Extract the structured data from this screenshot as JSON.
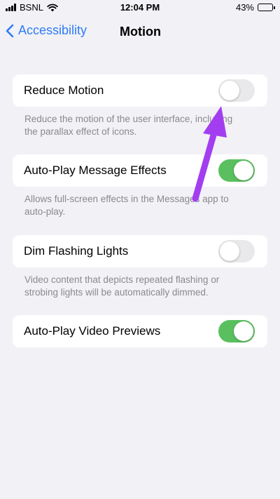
{
  "status_bar": {
    "carrier": "BSNL",
    "time": "12:04 PM",
    "battery": "43%"
  },
  "nav": {
    "back_label": "Accessibility",
    "title": "Motion"
  },
  "settings": [
    {
      "label": "Reduce Motion",
      "enabled": false,
      "footnote_line1": "Reduce the motion of the user interface, including",
      "footnote_line2": "the parallax effect of icons."
    },
    {
      "label": "Auto-Play Message Effects",
      "enabled": true,
      "footnote_line1": "Allows full-screen effects in the Messages app to",
      "footnote_line2": "auto-play."
    },
    {
      "label": "Dim Flashing Lights",
      "enabled": false,
      "footnote_line1": "Video content that depicts repeated flashing or",
      "footnote_line2": "strobing lights will be automatically dimmed."
    },
    {
      "label": "Auto-Play Video Previews",
      "enabled": true
    }
  ],
  "colors": {
    "background": "#f2f1f6",
    "accent_blue": "#2e7cf6",
    "toggle_on": "#5ac05f",
    "toggle_off": "#e9e9eb",
    "annotation_arrow": "#a33ef0"
  }
}
